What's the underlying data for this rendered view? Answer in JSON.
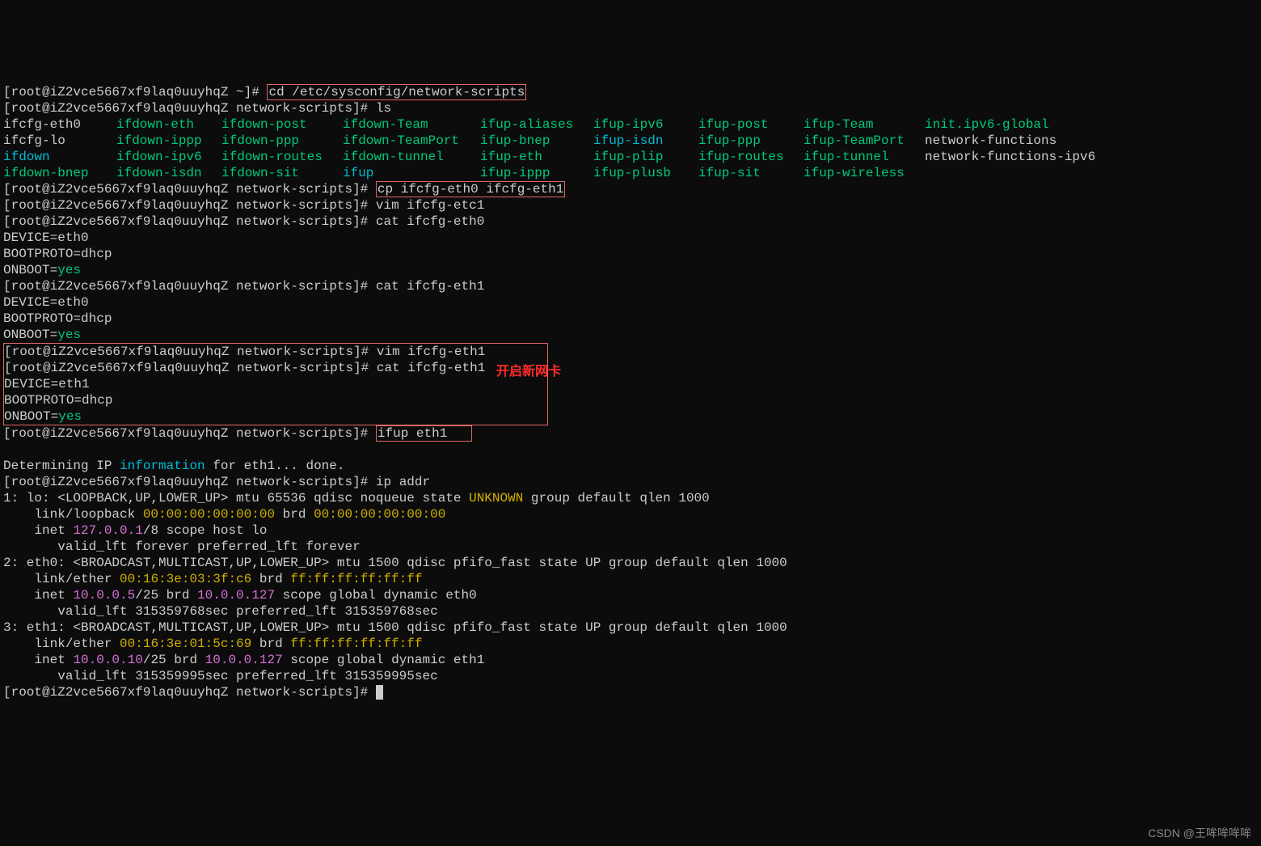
{
  "hostname_home": "[root@iZ2vce5667xf9laq0uuyhqZ ~]#",
  "hostname_ns": "[root@iZ2vce5667xf9laq0uuyhqZ network-scripts]#",
  "cmd_cd": "cd /etc/sysconfig/network-scripts",
  "cmd_ls": "ls",
  "cmd_cp": "cp ifcfg-eth0 ifcfg-eth1",
  "cmd_vim_etc1": "vim ifcfg-etc1",
  "cmd_cat_eth0": "cat ifcfg-eth0",
  "cmd_cat_eth1": "cat ifcfg-eth1",
  "cmd_vim_eth1": "vim ifcfg-eth1",
  "cmd_ifup": "ifup eth1",
  "cmd_ipaddr": "ip addr",
  "ls_out": {
    "col1": [
      "ifcfg-eth0",
      "ifcfg-lo",
      "ifdown",
      "ifdown-bnep"
    ],
    "col2": [
      "ifdown-eth",
      "ifdown-ippp",
      "ifdown-ipv6",
      "ifdown-isdn"
    ],
    "col3": [
      "ifdown-post",
      "ifdown-ppp",
      "ifdown-routes",
      "ifdown-sit"
    ],
    "col4": [
      "ifdown-Team",
      "ifdown-TeamPort",
      "ifdown-tunnel",
      "ifup"
    ],
    "col5": [
      "ifup-aliases",
      "ifup-bnep",
      "ifup-eth",
      "ifup-ippp"
    ],
    "col6": [
      "ifup-ipv6",
      "ifup-isdn",
      "ifup-plip",
      "ifup-plusb"
    ],
    "col7": [
      "ifup-post",
      "ifup-ppp",
      "ifup-routes",
      "ifup-sit"
    ],
    "col8": [
      "ifup-Team",
      "ifup-TeamPort",
      "ifup-tunnel",
      "ifup-wireless"
    ],
    "col9": [
      "init.ipv6-global",
      "network-functions",
      "network-functions-ipv6",
      ""
    ]
  },
  "cfg_eth0": {
    "device_k": "DEVICE=",
    "device_v": "eth0",
    "boot_k": "BOOTPROTO=",
    "boot_v": "dhcp",
    "onboot_k": "ONBOOT=",
    "onboot_v": "yes"
  },
  "cfg_eth1_old": {
    "device_k": "DEVICE=",
    "device_v": "eth0",
    "boot_k": "BOOTPROTO=",
    "boot_v": "dhcp",
    "onboot_k": "ONBOOT=",
    "onboot_v": "yes"
  },
  "cfg_eth1_new": {
    "device_k": "DEVICE=",
    "device_v": "eth1",
    "boot_k": "BOOTPROTO=",
    "boot_v": "dhcp",
    "onboot_k": "ONBOOT=",
    "onboot_v": "yes"
  },
  "blank": "",
  "determining_pre": "Determining IP ",
  "determining_info": "information",
  "determining_post": " for eth1... done.",
  "ip": {
    "lo_head_pre": "1: lo: <LOOPBACK,UP,LOWER_UP> mtu 65536 qdisc noqueue state ",
    "lo_state": "UNKNOWN",
    "lo_head_post": " group default qlen 1000",
    "lo_link_pre": "    link/loopback ",
    "lo_mac": "00:00:00:00:00:00",
    "lo_brd_lbl": " brd ",
    "lo_brd": "00:00:00:00:00:00",
    "lo_inet_pre": "    inet ",
    "lo_ip": "127.0.0.1",
    "lo_inet_post": "/8 scope host lo",
    "lo_valid": "       valid_lft forever preferred_lft forever",
    "eth0_head": "2: eth0: <BROADCAST,MULTICAST,UP,LOWER_UP> mtu 1500 qdisc pfifo_fast state UP group default qlen 1000",
    "eth0_link_pre": "    link/ether ",
    "eth0_mac": "00:16:3e:03:3f:c6",
    "eth0_brd_lbl": " brd ",
    "eth0_brd": "ff:ff:ff:ff:ff:ff",
    "eth0_inet_pre": "    inet ",
    "eth0_ip": "10.0.0.5",
    "eth0_inet_mid": "/25 brd ",
    "eth0_bcast": "10.0.0.127",
    "eth0_inet_post": " scope global dynamic eth0",
    "eth0_valid": "       valid_lft 315359768sec preferred_lft 315359768sec",
    "eth1_head": "3: eth1: <BROADCAST,MULTICAST,UP,LOWER_UP> mtu 1500 qdisc pfifo_fast state UP group default qlen 1000",
    "eth1_link_pre": "    link/ether ",
    "eth1_mac": "00:16:3e:01:5c:69",
    "eth1_brd_lbl": " brd ",
    "eth1_brd": "ff:ff:ff:ff:ff:ff",
    "eth1_inet_pre": "    inet ",
    "eth1_ip": "10.0.0.10",
    "eth1_inet_mid": "/25 brd ",
    "eth1_bcast": "10.0.0.127",
    "eth1_inet_post": " scope global dynamic eth1",
    "eth1_valid": "       valid_lft 315359995sec preferred_lft 315359995sec"
  },
  "annotation": "开启新网卡",
  "watermark": "CSDN @王哞哞哞哞"
}
